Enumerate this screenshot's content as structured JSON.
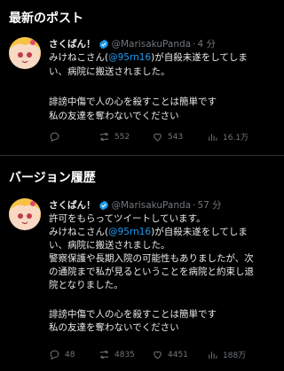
{
  "latest": {
    "section_title": "最新のポスト",
    "display_name": "さくぱん！",
    "handle": "@MarisakuPanda",
    "separator": "·",
    "time": "4 分",
    "lines": [
      {
        "pre": "みけねこさん(",
        "link": "@95rn16",
        "post": ")が自殺未遂をしてしま"
      },
      {
        "pre": "い、病院に搬送されました。",
        "link": "",
        "post": ""
      },
      {
        "pre": "誹謗中傷で人の心を殺すことは簡単です",
        "link": "",
        "post": ""
      },
      {
        "pre": "私の友達を奪わないでください",
        "link": "",
        "post": ""
      }
    ],
    "stats": {
      "replies": "",
      "reposts": "552",
      "likes": "543",
      "views": "16.1万"
    }
  },
  "version": {
    "section_title": "バージョン履歴",
    "display_name": "さくぱん！",
    "handle": "@MarisakuPanda",
    "separator": "·",
    "time": "57 分",
    "lines": [
      {
        "pre": "許可をもらってツイートしています。",
        "link": "",
        "post": ""
      },
      {
        "pre": "みけねこさん(",
        "link": "@95rn16",
        "post": ")が自殺未遂をしてしま"
      },
      {
        "pre": "い、病院に搬送されました。",
        "link": "",
        "post": ""
      },
      {
        "pre": "警察保護や長期入院の可能性もありましたが、次",
        "link": "",
        "post": ""
      },
      {
        "pre": "の通院まで私が見るということを病院と約束し退",
        "link": "",
        "post": ""
      },
      {
        "pre": "院となりました。",
        "link": "",
        "post": ""
      },
      {
        "pre": "誹謗中傷で人の心を殺すことは簡単です",
        "link": "",
        "post": ""
      },
      {
        "pre": "私の友達を奪わないでください",
        "link": "",
        "post": ""
      }
    ],
    "stats": {
      "replies": "48",
      "reposts": "4835",
      "likes": "4451",
      "views": "188万"
    }
  },
  "icons": {
    "verified": "verified-badge-icon",
    "reply": "reply-icon",
    "repost": "repost-icon",
    "like": "heart-icon",
    "views": "views-bar-chart-icon"
  },
  "colors": {
    "background": "#000000",
    "text": "#e7e9ea",
    "muted": "#71767b",
    "link": "#1d9bf0",
    "verified": "#1d9bf0"
  }
}
